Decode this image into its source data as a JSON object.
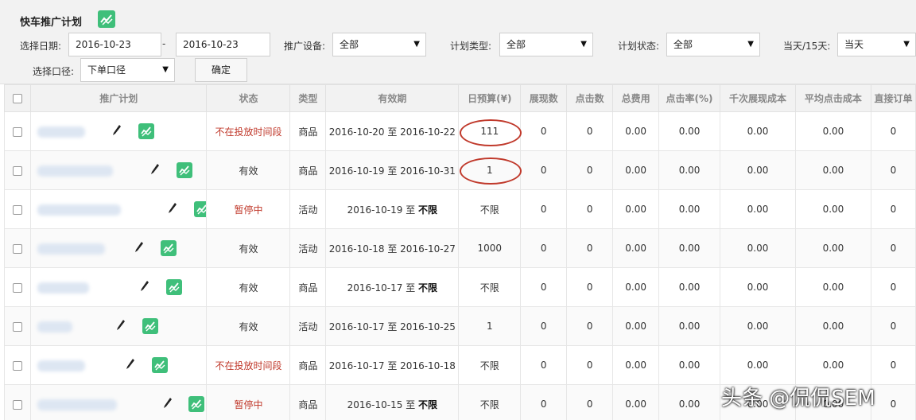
{
  "header": {
    "title": "快车推广计划",
    "date_label": "选择日期:",
    "date_start": "2016-10-23",
    "date_sep": "-",
    "date_end": "2016-10-23",
    "device_label": "推广设备:",
    "device_value": "全部",
    "plan_type_label": "计划类型:",
    "plan_type_value": "全部",
    "plan_status_label": "计划状态:",
    "plan_status_value": "全部",
    "period_label": "当天/15天:",
    "period_value": "当天",
    "caliber_label": "选择口径:",
    "caliber_value": "下单口径",
    "confirm_label": "确定"
  },
  "table": {
    "columns": [
      "推广计划",
      "状态",
      "类型",
      "有效期",
      "日预算(¥)",
      "展现数",
      "点击数",
      "总费用",
      "点击率(%)",
      "千次展现成本",
      "平均点击成本",
      "直接订单"
    ],
    "rows": [
      {
        "status": "不在投放时间段",
        "status_color": "#c0392b",
        "type": "商品",
        "period_start": "2016-10-20",
        "sep": "至",
        "period_end": "2016-10-22",
        "end_bold": false,
        "budget": "111",
        "impressions": "0",
        "clicks": "0",
        "cost": "0.00",
        "ctr": "0.00",
        "cpm": "0.00",
        "cpc": "0.00",
        "orders": "0"
      },
      {
        "status": "有效",
        "status_color": "#333333",
        "type": "商品",
        "period_start": "2016-10-19",
        "sep": "至",
        "period_end": "2016-10-31",
        "end_bold": false,
        "budget": "1",
        "impressions": "0",
        "clicks": "0",
        "cost": "0.00",
        "ctr": "0.00",
        "cpm": "0.00",
        "cpc": "0.00",
        "orders": "0"
      },
      {
        "status": "暂停中",
        "status_color": "#c0392b",
        "type": "活动",
        "period_start": "2016-10-19",
        "sep": "至",
        "period_end": "不限",
        "end_bold": true,
        "budget": "不限",
        "impressions": "0",
        "clicks": "0",
        "cost": "0.00",
        "ctr": "0.00",
        "cpm": "0.00",
        "cpc": "0.00",
        "orders": "0"
      },
      {
        "status": "有效",
        "status_color": "#333333",
        "type": "活动",
        "period_start": "2016-10-18",
        "sep": "至",
        "period_end": "2016-10-27",
        "end_bold": false,
        "budget": "1000",
        "impressions": "0",
        "clicks": "0",
        "cost": "0.00",
        "ctr": "0.00",
        "cpm": "0.00",
        "cpc": "0.00",
        "orders": "0"
      },
      {
        "status": "有效",
        "status_color": "#333333",
        "type": "商品",
        "period_start": "2016-10-17",
        "sep": "至",
        "period_end": "不限",
        "end_bold": true,
        "budget": "不限",
        "impressions": "0",
        "clicks": "0",
        "cost": "0.00",
        "ctr": "0.00",
        "cpm": "0.00",
        "cpc": "0.00",
        "orders": "0"
      },
      {
        "status": "有效",
        "status_color": "#333333",
        "type": "活动",
        "period_start": "2016-10-17",
        "sep": "至",
        "period_end": "2016-10-25",
        "end_bold": false,
        "budget": "1",
        "impressions": "0",
        "clicks": "0",
        "cost": "0.00",
        "ctr": "0.00",
        "cpm": "0.00",
        "cpc": "0.00",
        "orders": "0"
      },
      {
        "status": "不在投放时间段",
        "status_color": "#c0392b",
        "type": "商品",
        "period_start": "2016-10-17",
        "sep": "至",
        "period_end": "2016-10-18",
        "end_bold": false,
        "budget": "不限",
        "impressions": "0",
        "clicks": "0",
        "cost": "0.00",
        "ctr": "0.00",
        "cpm": "0.00",
        "cpc": "0.00",
        "orders": "0"
      },
      {
        "status": "暂停中",
        "status_color": "#c0392b",
        "type": "商品",
        "period_start": "2016-10-15",
        "sep": "至",
        "period_end": "不限",
        "end_bold": true,
        "budget": "不限",
        "impressions": "0",
        "clicks": "0",
        "cost": "0.00",
        "ctr": "0.00",
        "cpm": "0.00",
        "cpc": "0.00",
        "orders": "0"
      }
    ]
  },
  "annotation_color": "#c0392b",
  "accent_color": "#3fbf7a",
  "icons": [
    "trend-chart-icon",
    "edit-pencil-icon",
    "checkbox-icon",
    "dropdown-caret-icon"
  ],
  "watermark": "头条 @侃侃SEM"
}
